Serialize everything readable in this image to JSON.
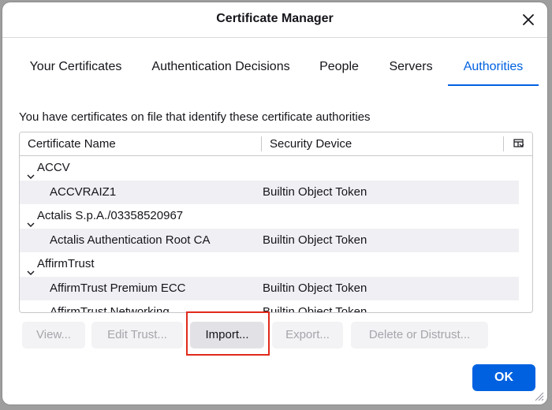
{
  "window": {
    "title": "Certificate Manager",
    "close_icon": "close-icon"
  },
  "tabs": [
    {
      "label": "Your Certificates",
      "selected": false
    },
    {
      "label": "Authentication Decisions",
      "selected": false
    },
    {
      "label": "People",
      "selected": false
    },
    {
      "label": "Servers",
      "selected": false
    },
    {
      "label": "Authorities",
      "selected": true
    }
  ],
  "description": "You have certificates on file that identify these certificate authorities",
  "table": {
    "columns": [
      "Certificate Name",
      "Security Device"
    ],
    "column_picker_icon": "column-picker-icon",
    "rows": [
      {
        "type": "group",
        "name": "ACCV",
        "expanded": true
      },
      {
        "type": "cert",
        "name": "ACCVRAIZ1",
        "device": "Builtin Object Token"
      },
      {
        "type": "group",
        "name": "Actalis S.p.A./03358520967",
        "expanded": true
      },
      {
        "type": "cert",
        "name": "Actalis Authentication Root CA",
        "device": "Builtin Object Token"
      },
      {
        "type": "group",
        "name": "AffirmTrust",
        "expanded": true
      },
      {
        "type": "cert",
        "name": "AffirmTrust Premium ECC",
        "device": "Builtin Object Token"
      },
      {
        "type": "cert",
        "name": "AffirmTrust Networking",
        "device": "Builtin Object Token"
      }
    ]
  },
  "buttons": {
    "view": "View...",
    "edit_trust": "Edit Trust...",
    "import": "Import...",
    "export": "Export...",
    "delete": "Delete or Distrust...",
    "ok": "OK"
  },
  "colors": {
    "accent": "#0061e0",
    "highlight": "#e02a1c"
  }
}
